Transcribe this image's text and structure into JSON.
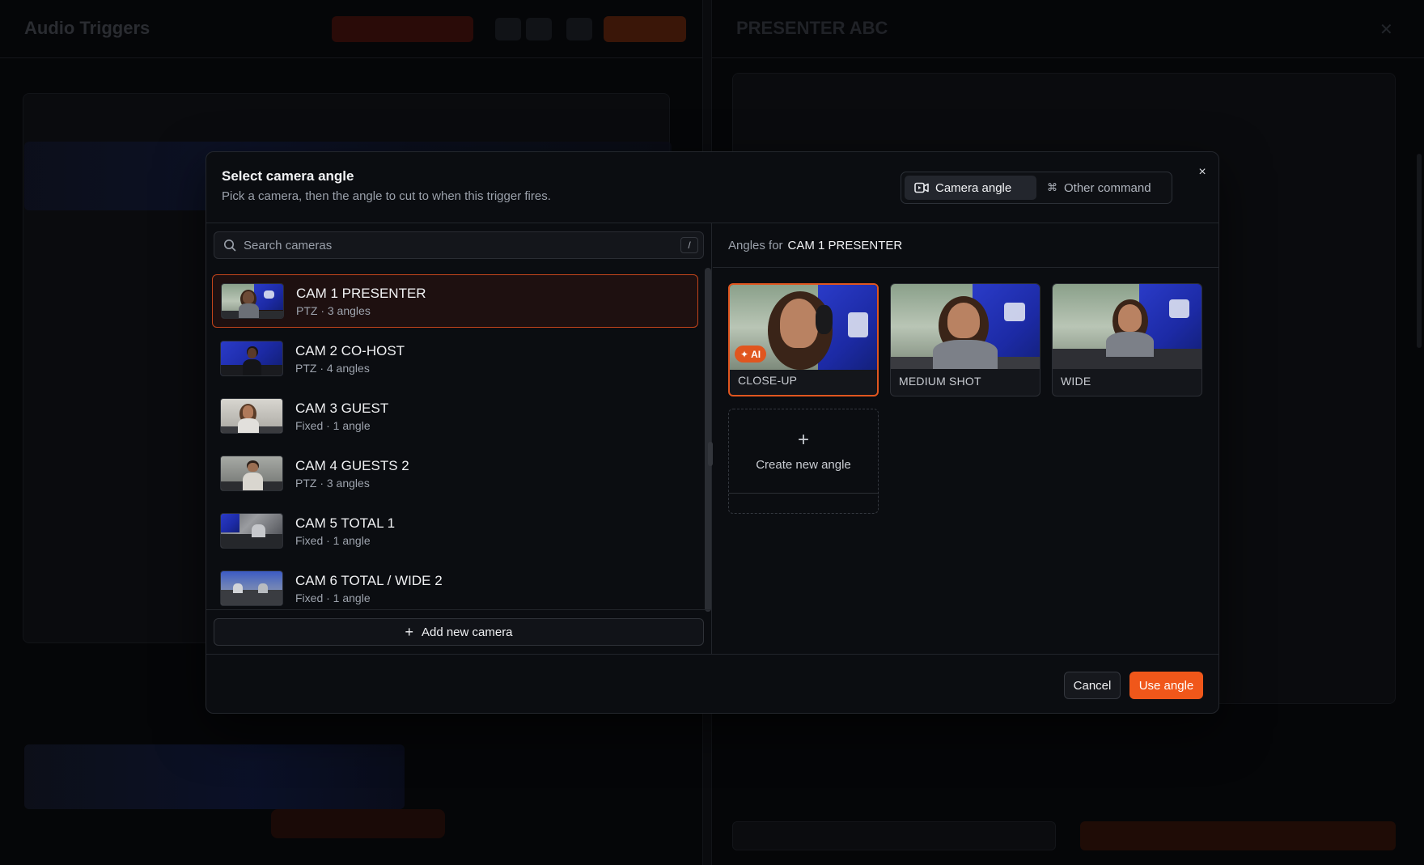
{
  "background": {
    "app_title": "Audio Triggers",
    "right_title": "PRESENTER ABC"
  },
  "modal": {
    "title": "Select camera angle",
    "subtitle": "Pick a camera, then the angle to cut to when this trigger fires.",
    "tabs": [
      {
        "label": "Camera angle",
        "icon": "video-camera-icon",
        "active": true
      },
      {
        "label": "Other command",
        "icon": "command-icon",
        "active": false
      }
    ],
    "close_label": "×",
    "search": {
      "placeholder": "Search cameras",
      "value": "",
      "shortcut": "/"
    },
    "cameras": [
      {
        "name": "CAM 1 PRESENTER",
        "meta": "PTZ · 3 angles",
        "selected": true
      },
      {
        "name": "CAM 2 CO-HOST",
        "meta": "PTZ · 4 angles",
        "selected": false
      },
      {
        "name": "CAM 3 GUEST",
        "meta": "Fixed · 1 angle",
        "selected": false
      },
      {
        "name": "CAM 4 GUESTS 2",
        "meta": "PTZ · 3 angles",
        "selected": false
      },
      {
        "name": "CAM 5 TOTAL 1",
        "meta": "Fixed · 1 angle",
        "selected": false
      },
      {
        "name": "CAM 6 TOTAL / WIDE 2",
        "meta": "Fixed · 1 angle",
        "selected": false
      }
    ],
    "add_camera_label": "Add new camera",
    "angles_prefix": "Angles for",
    "angles_camera": "CAM 1 PRESENTER",
    "angles": [
      {
        "label": "CLOSE-UP",
        "badge": "AI",
        "selected": true
      },
      {
        "label": "MEDIUM SHOT",
        "badge": "",
        "selected": false
      },
      {
        "label": "WIDE",
        "badge": "",
        "selected": false
      }
    ],
    "create_angle_label": "Create new angle",
    "cancel_label": "Cancel",
    "use_label": "Use angle"
  },
  "colors": {
    "accent": "#f0571a",
    "selected_border": "#c2441b",
    "modal_bg": "#0b0d11"
  }
}
